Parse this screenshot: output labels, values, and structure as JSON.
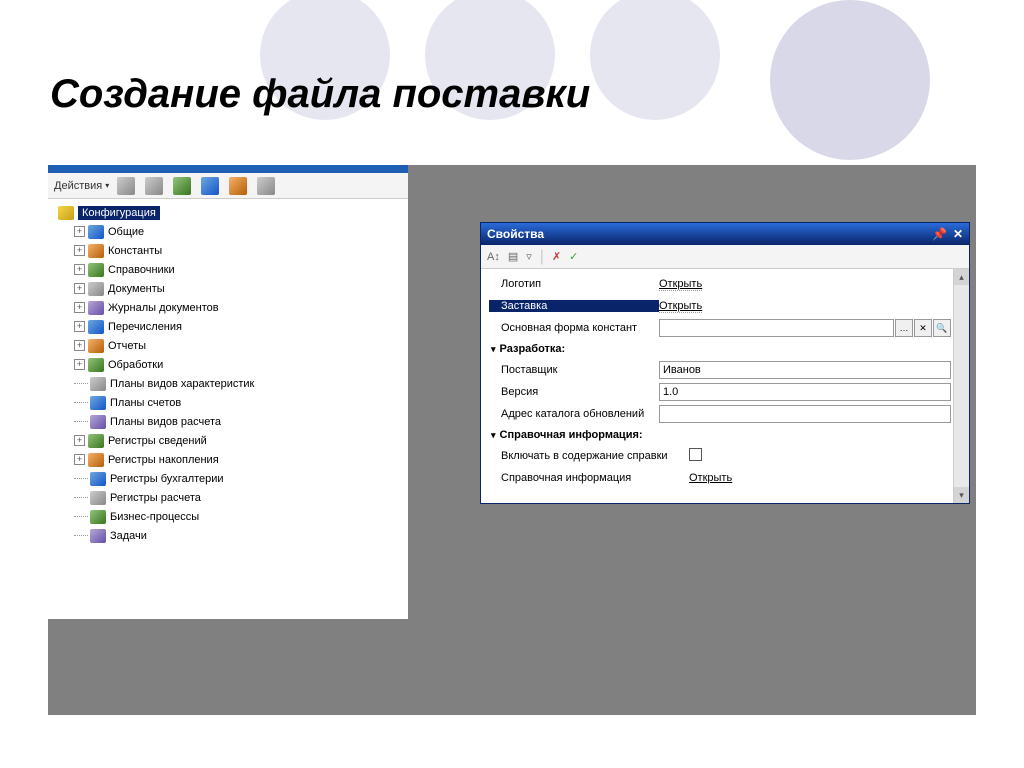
{
  "slide_title": "Создание файла поставки",
  "tree": {
    "actions_label": "Действия",
    "root_label": "Конфигурация",
    "items": [
      {
        "label": "Общие",
        "expandable": true
      },
      {
        "label": "Константы",
        "expandable": true
      },
      {
        "label": "Справочники",
        "expandable": true
      },
      {
        "label": "Документы",
        "expandable": true
      },
      {
        "label": "Журналы документов",
        "expandable": true
      },
      {
        "label": "Перечисления",
        "expandable": true
      },
      {
        "label": "Отчеты",
        "expandable": true
      },
      {
        "label": "Обработки",
        "expandable": true
      },
      {
        "label": "Планы видов характеристик",
        "expandable": false
      },
      {
        "label": "Планы счетов",
        "expandable": false
      },
      {
        "label": "Планы видов расчета",
        "expandable": false
      },
      {
        "label": "Регистры сведений",
        "expandable": true
      },
      {
        "label": "Регистры накопления",
        "expandable": true
      },
      {
        "label": "Регистры бухгалтерии",
        "expandable": false
      },
      {
        "label": "Регистры расчета",
        "expandable": false
      },
      {
        "label": "Бизнес-процессы",
        "expandable": false
      },
      {
        "label": "Задачи",
        "expandable": false
      }
    ]
  },
  "props": {
    "title": "Свойства",
    "rows": {
      "logo_label": "Логотип",
      "logo_action": "Открыть",
      "splash_label": "Заставка",
      "splash_action": "Открыть",
      "const_form_label": "Основная форма констант",
      "const_form_value": ""
    },
    "sections": {
      "dev_header": "Разработка:",
      "vendor_label": "Поставщик",
      "vendor_value": "Иванов",
      "version_label": "Версия",
      "version_value": "1.0",
      "update_catalog_label": "Адрес каталога обновлений",
      "update_catalog_value": "",
      "help_header": "Справочная информация:",
      "help_include_label": "Включать в содержание справки",
      "help_info_label": "Справочная информация",
      "help_info_action": "Открыть"
    }
  }
}
